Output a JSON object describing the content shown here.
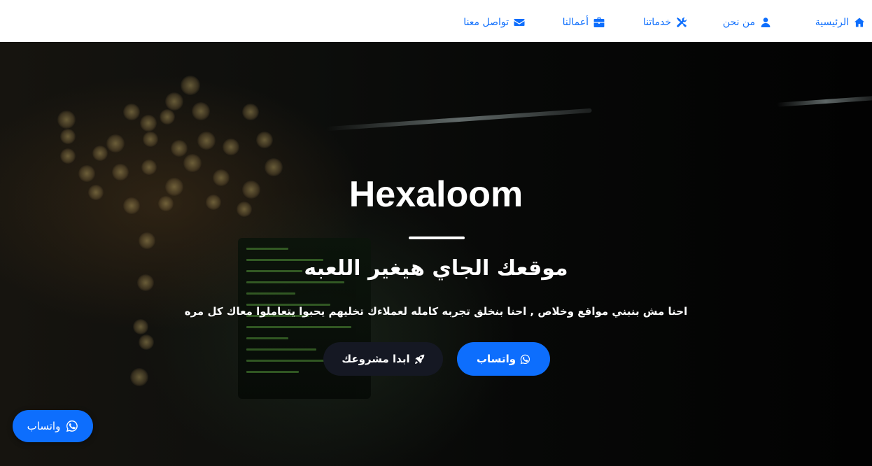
{
  "nav": {
    "home": "الرئيسية",
    "about": "من نحن",
    "services": "خدماتنا",
    "works": "أعمالنا",
    "contact": "تواصل معنا"
  },
  "hero": {
    "title": "Hexaloom",
    "subtitle": "موقعك الجاي هيغير اللعبه",
    "text": "احنا مش بنبني مواقع وخلاص , احنا بنخلق تجربه كامله لعملاءك تخليهم يحبوا يتعاملوا معاك كل مره",
    "whatsapp_button": "واتساب",
    "start_button": "ابدا مشروعك"
  },
  "floating": {
    "whatsapp_label": "واتساب"
  },
  "icons": {
    "home": "home-icon",
    "about": "user-icon",
    "services": "tools-icon",
    "works": "briefcase-icon",
    "contact": "envelope-icon",
    "whatsapp": "whatsapp-icon",
    "rocket": "rocket-icon"
  },
  "colors": {
    "accent": "#0d6efd",
    "nav_bg": "#ffffff",
    "dark_button": "#151823"
  }
}
